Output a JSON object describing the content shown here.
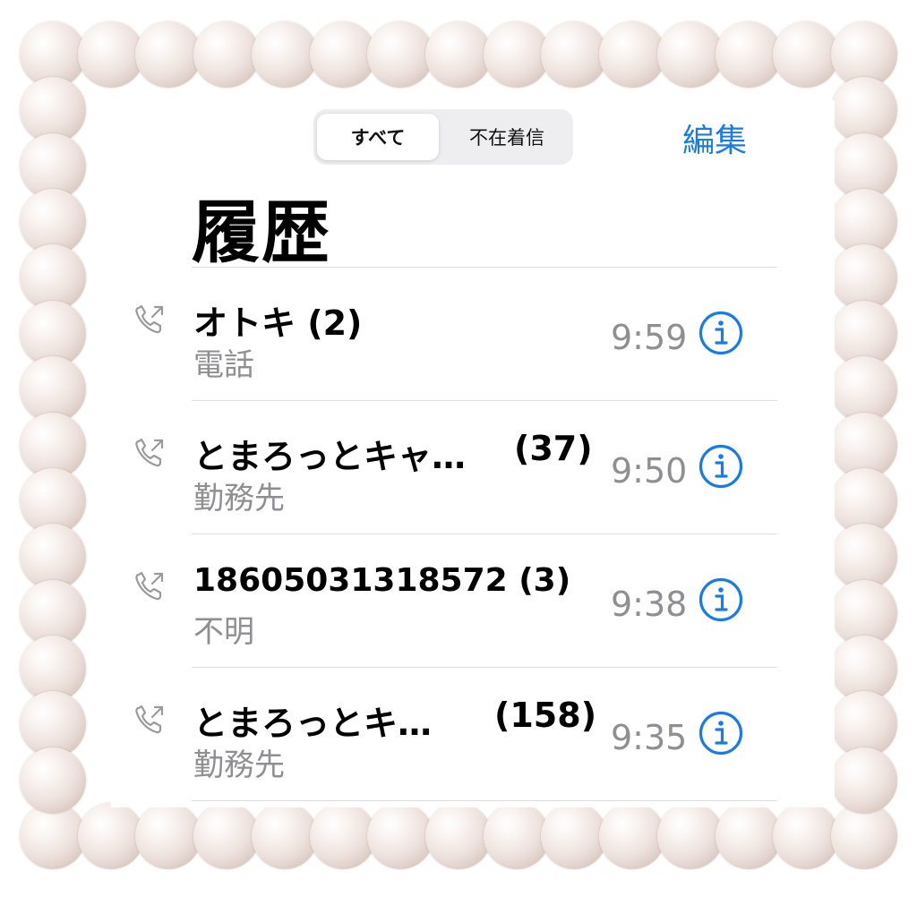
{
  "header": {
    "tabs": [
      {
        "label": "すべて",
        "selected": true
      },
      {
        "label": "不在着信",
        "selected": false
      }
    ],
    "edit_label": "編集",
    "title": "履歴"
  },
  "calls": [
    {
      "name": "オトキ (2)",
      "count": "",
      "kind": "電話",
      "time": "9:59"
    },
    {
      "name": "とまろっとキャ…",
      "count": "(37)",
      "kind": "勤務先",
      "time": "9:50"
    },
    {
      "name": "18605031318572 (3)",
      "count": "",
      "kind": "不明",
      "time": "9:38"
    },
    {
      "name": "とまろっとキ…",
      "count": "(158)",
      "kind": "勤務先",
      "time": "9:35"
    }
  ],
  "colors": {
    "accent": "#1a7be0",
    "secondary_text": "#8e8e93",
    "pearl": "#e9dcd7"
  },
  "icons": {
    "outgoing_call": "phone-outgoing-icon",
    "info": "info-circle-icon"
  }
}
